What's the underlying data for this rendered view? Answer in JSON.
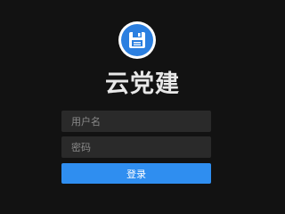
{
  "app": {
    "title": "云党建"
  },
  "logo": {
    "icon": "floppy-disk-icon",
    "ring_color": "#ffffff",
    "fill_color": "#2b7fe0"
  },
  "form": {
    "username": {
      "placeholder": "用户名",
      "value": ""
    },
    "password": {
      "placeholder": "密码",
      "value": ""
    },
    "submit_label": "登录"
  },
  "colors": {
    "background": "#121212",
    "field": "#2a2a2a",
    "accent": "#2f8ef0"
  }
}
